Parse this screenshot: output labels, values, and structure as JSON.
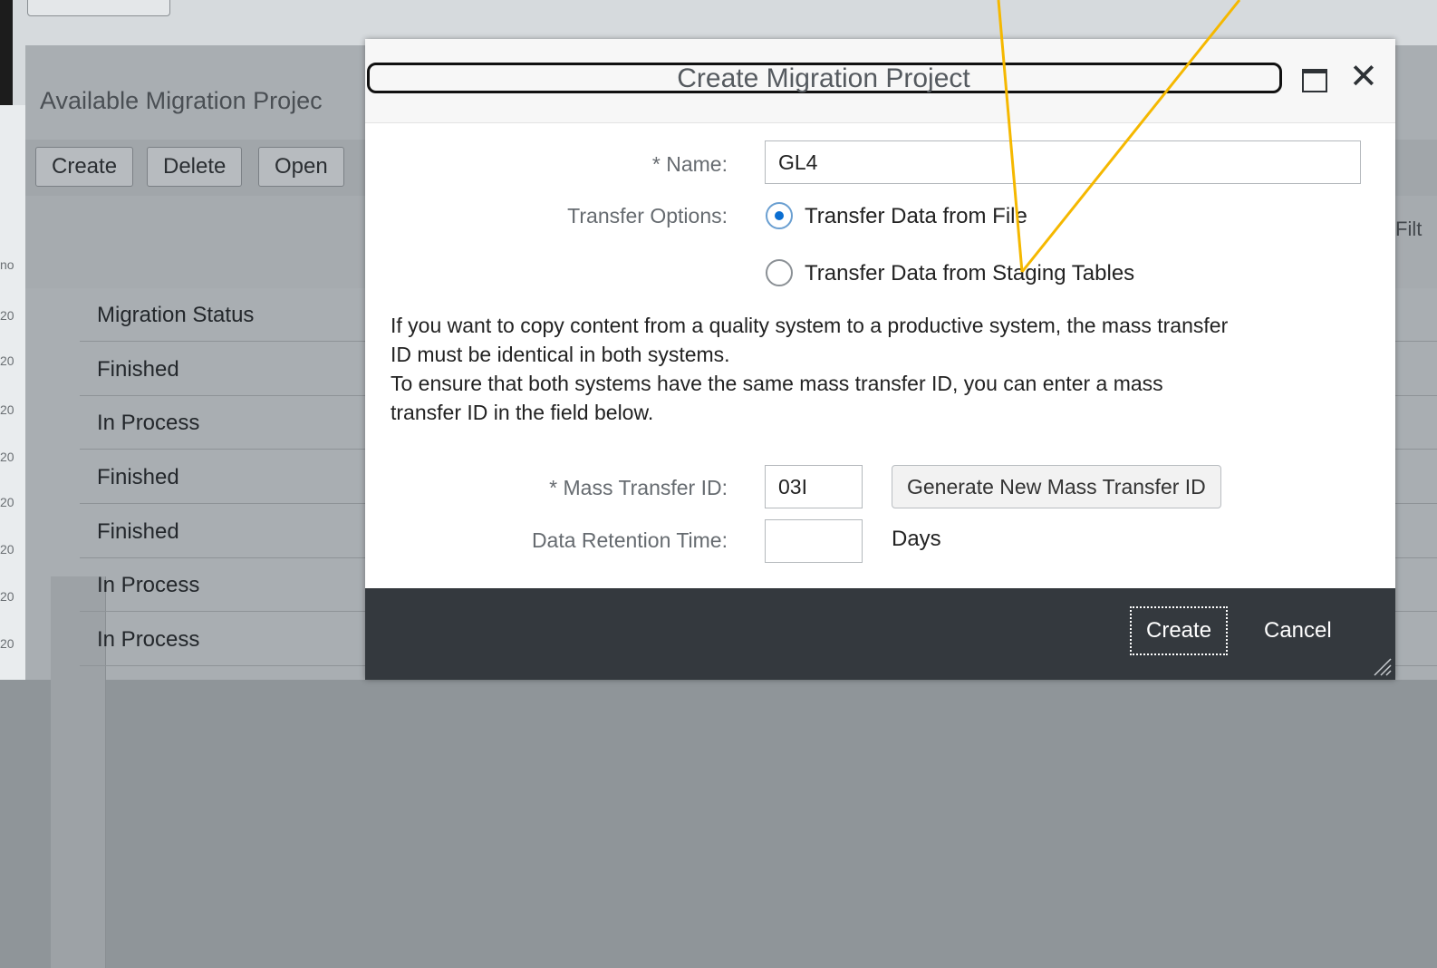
{
  "background": {
    "panel_title": "Available Migration Projec",
    "toolbar_buttons": [
      "Create",
      "Delete",
      "Open"
    ],
    "filter_text": "Filt",
    "left_col_items": [
      "no",
      "20",
      "20",
      "20",
      "20",
      "20",
      "20",
      "20",
      "20"
    ],
    "table": {
      "header": "Migration Status",
      "rows": [
        "Finished",
        "In Process",
        "Finished",
        "Finished",
        "In Process",
        "In Process"
      ]
    }
  },
  "dialog": {
    "title": "Create Migration Project",
    "name_label": "* Name:",
    "name_value": "GL4",
    "transfer_options_label": "Transfer Options:",
    "option_file": "Transfer Data from File",
    "option_staging": "Transfer Data from Staging Tables",
    "selected_option": "Transfer Data from File",
    "info_lines": [
      "If you want to copy content from a quality system to a productive system, the mass transfer",
      "ID must be identical in both systems.",
      "To ensure that both systems have the same mass transfer ID, you can enter a mass",
      "transfer ID in the field below."
    ],
    "mass_transfer_label": "* Mass Transfer ID:",
    "mass_transfer_value": "03I",
    "generate_button": "Generate New Mass Transfer ID",
    "retention_label": "Data Retention Time:",
    "retention_value": "",
    "days_label": "Days",
    "footer": {
      "create": "Create",
      "cancel": "Cancel"
    }
  },
  "colors": {
    "annotation_arrow": "#f5b800",
    "footer_bg": "#34393e",
    "radio_selected": "#0a6ed1"
  }
}
